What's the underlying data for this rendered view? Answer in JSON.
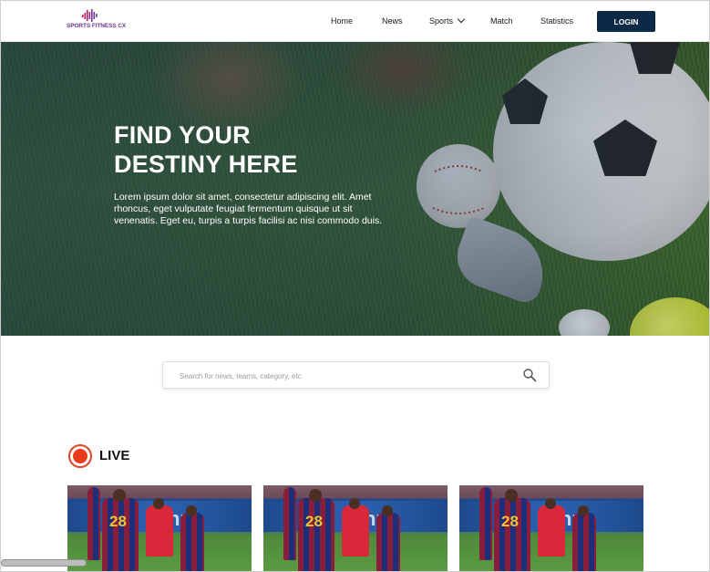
{
  "brand": {
    "name": "SPORTS FITNESS CX",
    "color": "#6a3a8c",
    "icon": "equalizer-bars-icon"
  },
  "nav": {
    "items": [
      {
        "label": "Home"
      },
      {
        "label": "News"
      },
      {
        "label": "Sports"
      },
      {
        "label": "Match"
      },
      {
        "label": "Statistics"
      }
    ],
    "login_label": "LOGIN",
    "login_color": "#0c2a45"
  },
  "hero": {
    "title_line1": "FIND YOUR",
    "title_line2": "DESTINY HERE",
    "text": "Lorem ipsum dolor sit amet, consectetur adipiscing elit. Amet rhoncus, eget vulputate feugiat fermentum quisque ut sit venenatis. Eget eu, turpis a turpis facilisi ac nisi commodo duis."
  },
  "search": {
    "placeholder": "Search for news, teams, category, etc",
    "value": "",
    "icon": "search-icon"
  },
  "live": {
    "label": "LIVE",
    "indicator_color": "#e73b1d",
    "cards": [
      {
        "image": "football-match-photo",
        "jersey_number": "28",
        "ad_text": "nz"
      },
      {
        "image": "football-match-photo",
        "jersey_number": "28",
        "ad_text": "nz"
      },
      {
        "image": "football-match-photo",
        "jersey_number": "28",
        "ad_text": "nz"
      }
    ]
  }
}
